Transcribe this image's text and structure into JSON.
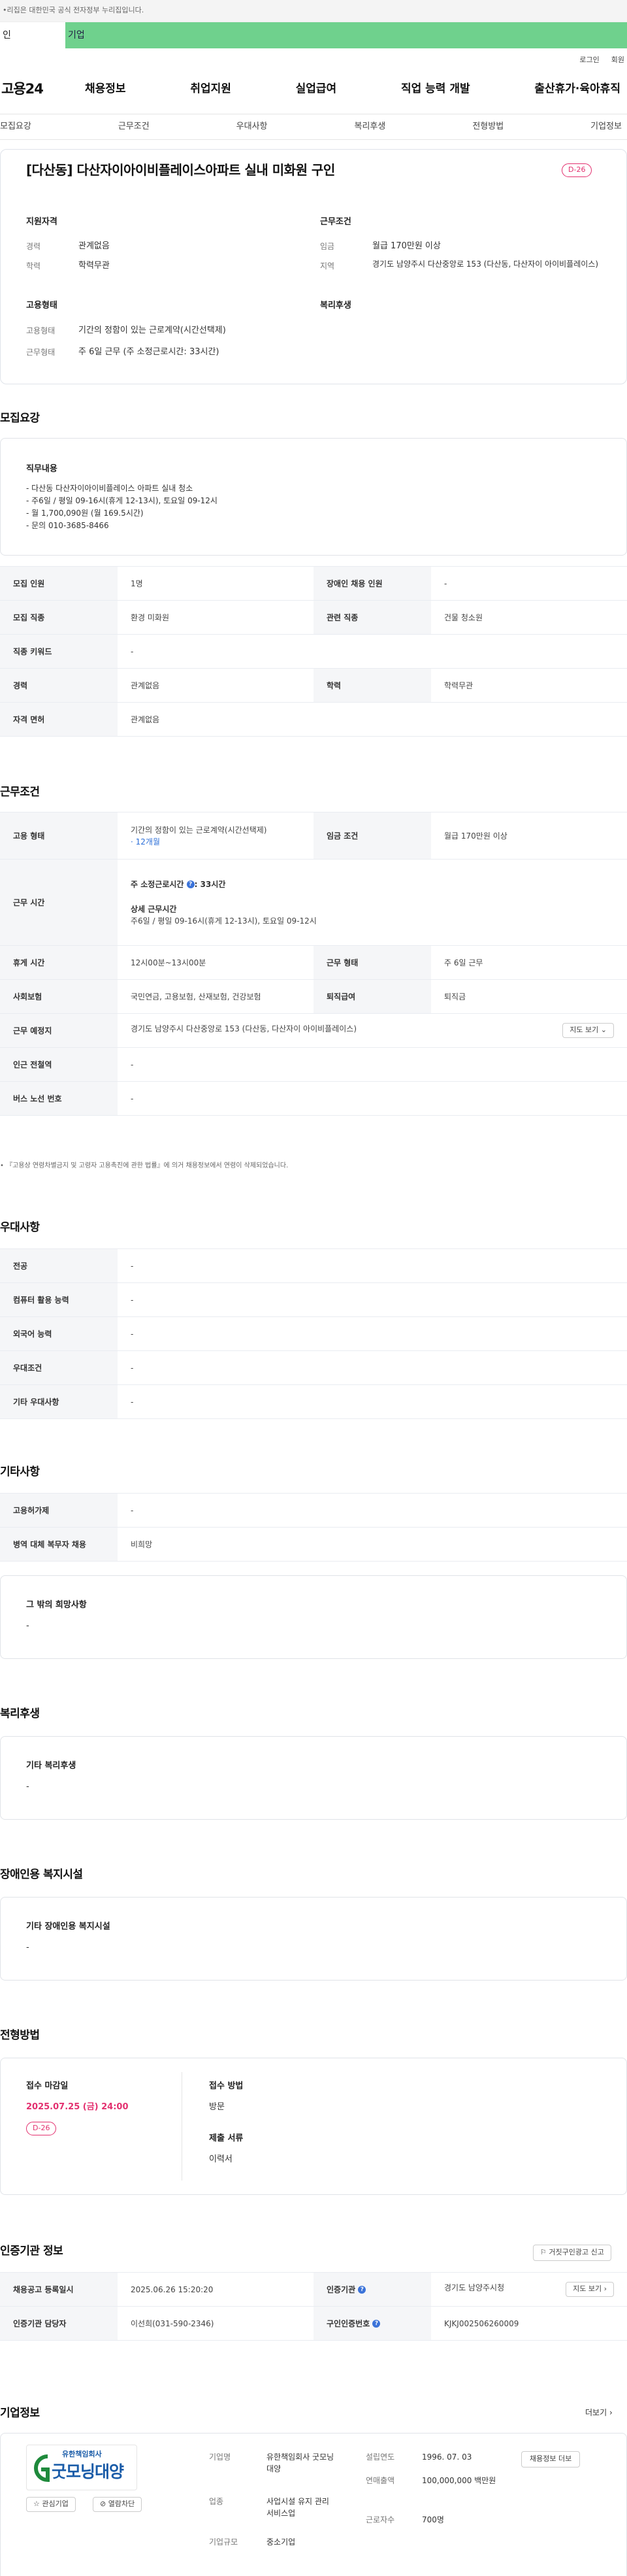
{
  "gov_notice": "•리집은 대한민국 공식 전자정부 누리집입니다.",
  "persona_tabs": [
    "인",
    "기업"
  ],
  "util_links": [
    "로그인",
    "회원"
  ],
  "site": {
    "logo": "고용24"
  },
  "gnb": [
    "채용정보",
    "취업지원",
    "실업급여",
    "직업 능력 개발",
    "출산휴가·육아휴직"
  ],
  "subtabs": [
    "모집요강",
    "근무조건",
    "우대사항",
    "복리후생",
    "전형방법",
    "기업정보"
  ],
  "summary": {
    "title": "[다산동] 다산자이아이비플레이스아파트 실내 미화원 구인",
    "dday": "D-26",
    "qual_title": "지원자격",
    "career_label": "경력",
    "career": "관계없음",
    "edu_label": "학력",
    "edu": "학력무관",
    "cond_title": "근무조건",
    "wage_label": "임금",
    "wage": "월급 170만원 이상",
    "region_label": "지역",
    "region": "경기도 남양주시 다산중앙로 153 (다산동, 다산자이 아이비플레이스)",
    "emp_title": "고용형태",
    "emp_label": "고용형태",
    "emp": "기간의 정함이 있는 근로계약(시간선택제)",
    "worktype_label": "근무형태",
    "worktype": "주 6일 근무 (주 소정근로시간: 33시간)",
    "welfare_title": "복리후생"
  },
  "recruit": {
    "section": "모집요강",
    "duty_title": "직무내용",
    "duty_lines": [
      "- 다산동 다산자이아이비플레이스 아파트 실내 청소",
      "- 주6일 / 평일 09-16시(휴게 12-13시), 토요일 09-12시",
      "- 월 1,700,090원 (월 169.5시간)",
      "- 문의 010-3685-8466"
    ],
    "rows": [
      [
        "모집 인원",
        "1명",
        "장애인 채용 인원",
        "-"
      ],
      [
        "모집 직종",
        "환경 미화원",
        "관련 직종",
        "건물 청소원"
      ],
      [
        "직종 키워드",
        "-"
      ],
      [
        "경력",
        "관계없음",
        "학력",
        "학력무관"
      ],
      [
        "자격 면허",
        "관계없음"
      ]
    ]
  },
  "work": {
    "section": "근무조건",
    "emp_k": "고용 형태",
    "emp_v": "기간의 정함이 있는 근로계약(시간선택제)",
    "emp_period": "· 12개월",
    "wage_k": "임금 조건",
    "wage_v": "월급 170만원 이상",
    "hours_k": "근무 시간",
    "hours_main": "주 소정근로시간",
    "hours_main_v": ": 33시간",
    "hours_detail_t": "상세 근무시간",
    "hours_detail": "주6일 / 평일 09-16시(휴게 12-13시), 토요일 09-12시",
    "rest_k": "휴게 시간",
    "rest_v": "12시00분~13시00분",
    "form_k": "근무 형태",
    "form_v": "주 6일 근무",
    "ins_k": "사회보험",
    "ins_v": "국민연금, 고용보험, 산재보험, 건강보험",
    "sev_k": "퇴직급여",
    "sev_v": "퇴직금",
    "place_k": "근무 예정지",
    "place_v": "경기도 남양주시 다산중앙로 153 (다산동, 다산자이 아이비플레이스)",
    "map_btn": "지도 보기",
    "subway_k": "인근 전철역",
    "subway_v": "-",
    "bus_k": "버스 노선 번호",
    "bus_v": "-",
    "note": "• 『고용상 연령차별금지 및 고령자 고용촉진에 관한 법률』에 의거 채용정보에서 연령이 삭제되었습니다."
  },
  "pref": {
    "section": "우대사항",
    "rows": [
      [
        "전공",
        "-"
      ],
      [
        "컴퓨터 활용 능력",
        "-"
      ],
      [
        "외국어 능력",
        "-"
      ],
      [
        "우대조건",
        "-"
      ],
      [
        "기타 우대사항",
        "-"
      ]
    ]
  },
  "etc": {
    "section": "기타사항",
    "rows": [
      [
        "고용허가제",
        "-"
      ],
      [
        "병역 대체 복무자 채용",
        "비희망"
      ]
    ],
    "hope_title": "그 밖의 희망사항",
    "hope_v": "-"
  },
  "welfare": {
    "section": "복리후생",
    "title": "기타 복리후생",
    "v": "-"
  },
  "disab": {
    "section": "장애인용 복지시설",
    "title": "기타 장애인용 복지시설",
    "v": "-"
  },
  "select": {
    "section": "전형방법",
    "deadline_t": "접수 마감일",
    "deadline": "2025.07.25 (금) 24:00",
    "dday": "D-26",
    "method_t": "접수 방법",
    "method": "방문",
    "docs_t": "제출 서류",
    "docs": "이력서"
  },
  "cert": {
    "section": "인증기관 정보",
    "report_btn": "거짓구인광고 신고",
    "reg_k": "채용공고 등록일시",
    "reg_v": "2025.06.26 15:20:20",
    "org_k": "인증기관",
    "org_v": "경기도 남양주시청",
    "map_btn": "지도 보기",
    "mgr_k": "인증기관 담당자",
    "mgr_v": "이선희(031-590-2346)",
    "id_k": "구인인증번호",
    "id_v": "KJKJ002506260009"
  },
  "company": {
    "section": "기업정보",
    "more": "더보기",
    "logo_small": "유한책임회사",
    "logo_big": "굿모닝대양",
    "fav_btn": "관심기업",
    "block_btn": "열람차단",
    "name_k": "기업명",
    "name_v": "유한책임회사 굿모닝대양",
    "ind_k": "업종",
    "ind_v": "사업시설 유지 관리 서비스업",
    "size_k": "기업규모",
    "size_v": "중소기업",
    "est_k": "설립연도",
    "est_v": "1996. 07. 03",
    "sales_k": "연매출액",
    "sales_v": "100,000,000 백만원",
    "emp_k": "근로자수",
    "emp_v": "700명",
    "jobs_btn": "채용정보 더보"
  }
}
